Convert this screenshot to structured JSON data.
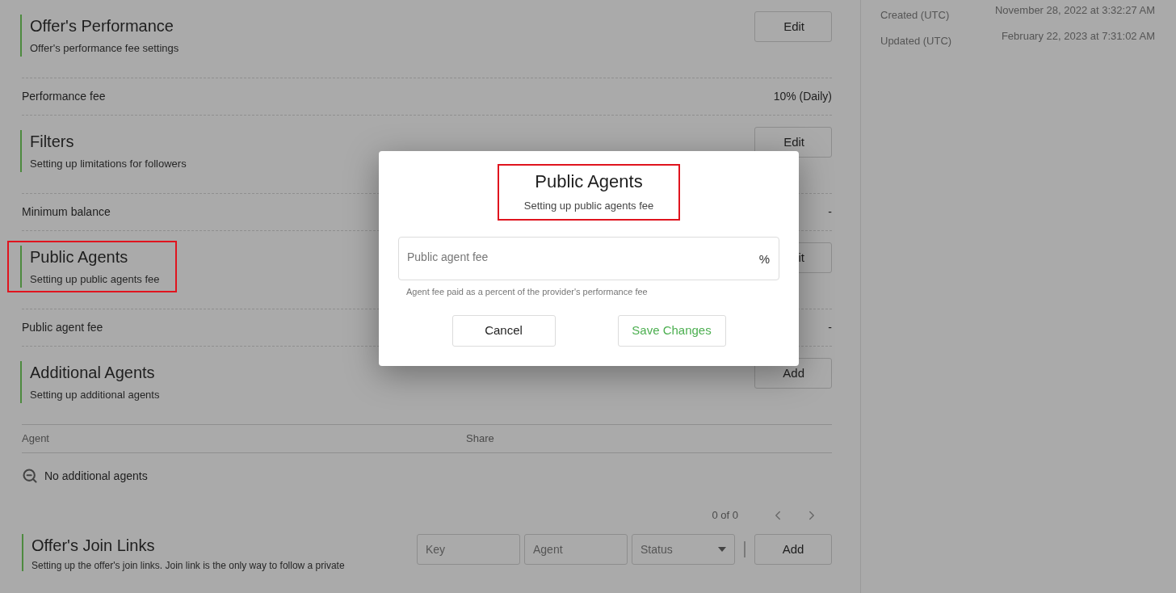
{
  "sections": [
    {
      "kind": "header",
      "title": "Offer's Performance",
      "subtitle": "Offer's performance fee settings",
      "button": "Edit",
      "highlighted": false
    },
    {
      "kind": "row",
      "label": "Performance fee",
      "value": "10% (Daily)"
    },
    {
      "kind": "header",
      "title": "Filters",
      "subtitle": "Setting up limitations for followers",
      "button": "Edit",
      "highlighted": false
    },
    {
      "kind": "row",
      "label": "Minimum balance",
      "value": "-"
    },
    {
      "kind": "header",
      "title": "Public Agents",
      "subtitle": "Setting up public agents fee",
      "button": "it",
      "highlighted": true
    },
    {
      "kind": "row",
      "label": "Public agent fee",
      "value": "-"
    },
    {
      "kind": "header",
      "title": "Additional Agents",
      "subtitle": "Setting up additional agents",
      "button": "Add",
      "highlighted": false
    },
    {
      "kind": "table",
      "columns": [
        "Agent",
        "Share"
      ],
      "empty_text": "No additional agents",
      "pagination": "0 of 0"
    },
    {
      "kind": "join_links",
      "title": "Offer's Join Links",
      "subtitle": "Setting up the offer's join links. Join link is the only way to follow a private",
      "filters": [
        {
          "kind": "input",
          "placeholder": "Key"
        },
        {
          "kind": "input",
          "placeholder": "Agent"
        },
        {
          "kind": "select",
          "placeholder": "Status"
        }
      ],
      "button": "Add"
    }
  ],
  "details": [
    {
      "label": "Created (UTC)",
      "value": "November 28, 2022 at 3:32:27 AM"
    },
    {
      "label": "Updated (UTC)",
      "value": "February 22, 2023 at 7:31:02 AM"
    }
  ],
  "modal": {
    "title": "Public Agents",
    "subtitle": "Setting up public agents fee",
    "highlighted": true,
    "field": {
      "placeholder": "Public agent fee",
      "suffix": "%",
      "hint": "Agent fee paid as a percent of the provider's performance fee"
    },
    "buttons": [
      {
        "label": "Cancel",
        "kind": "secondary"
      },
      {
        "label": "Save Changes",
        "kind": "primary"
      }
    ]
  }
}
